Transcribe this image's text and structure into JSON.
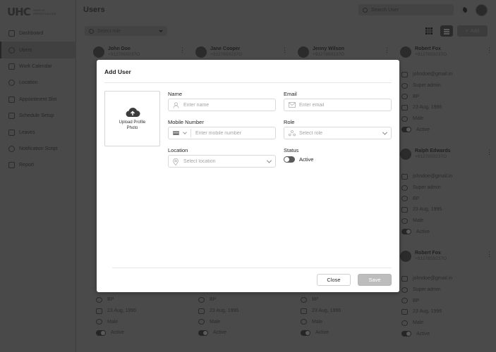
{
  "app": {
    "logo_text": "UHC",
    "logo_tagline": "Yuge at Opportunities",
    "page_title": "Users",
    "search_placeholder": "Search User"
  },
  "sidebar": {
    "items": [
      {
        "label": "Dashboard"
      },
      {
        "label": "Users"
      },
      {
        "label": "Work Calendar"
      },
      {
        "label": "Location"
      },
      {
        "label": "Appointment Slot"
      },
      {
        "label": "Schedule Setup"
      },
      {
        "label": "Leaves"
      },
      {
        "label": "Notification Script"
      },
      {
        "label": "Report"
      }
    ],
    "active_index": 1
  },
  "toolbar": {
    "filter_placeholder": "Select role",
    "add_label": "Add"
  },
  "cards": [
    {
      "name": "John Doe",
      "phone": "+9127859237O"
    },
    {
      "name": "Jane Cooper",
      "phone": "+9127859237O"
    },
    {
      "name": "Jenny Wilson",
      "phone": "+9127859237O"
    },
    {
      "name": "Robert Fox",
      "phone": "+9127859237O",
      "email": "johndoe@gmail.in",
      "role": "Super admin",
      "location": "BP",
      "dob": "23 Aug, 1996",
      "gender": "Male",
      "status": "Active"
    },
    {
      "name": "Ralph Edwards",
      "phone": "+9127859237O",
      "email": "johndoe@gmail.in",
      "role": "Super admin",
      "location": "BP",
      "dob": "23 Aug, 1996",
      "gender": "Male",
      "status": "Active"
    },
    {
      "name": "Robert Fox",
      "phone": "+9127859237O",
      "email": "johndoe@gmail.in",
      "role": "Super admin",
      "location": "BP",
      "dob": "23 Aug, 1996",
      "gender": "Male",
      "status": "Active"
    }
  ],
  "bottom_cards": [
    {
      "location": "BP",
      "dob": "23 Aug, 1996",
      "gender": "Male",
      "status": "Active"
    },
    {
      "location": "BP",
      "dob": "23 Aug, 1996",
      "gender": "Male",
      "status": "Active"
    },
    {
      "location": "BP",
      "dob": "23 Aug, 1996",
      "gender": "Male",
      "status": "Active"
    }
  ],
  "modal": {
    "title": "Add User",
    "upload_label": "Upload Profile Photo",
    "name_label": "Name",
    "name_placeholder": "Enter name",
    "email_label": "Email",
    "email_placeholder": "Enter email",
    "mobile_label": "Mobile Number",
    "mobile_placeholder": "Enter mobile number",
    "role_label": "Role",
    "role_placeholder": "Select role",
    "location_label": "Location",
    "location_placeholder": "Select location",
    "status_label": "Status",
    "status_value": "Active",
    "close_label": "Close",
    "save_label": "Save"
  }
}
